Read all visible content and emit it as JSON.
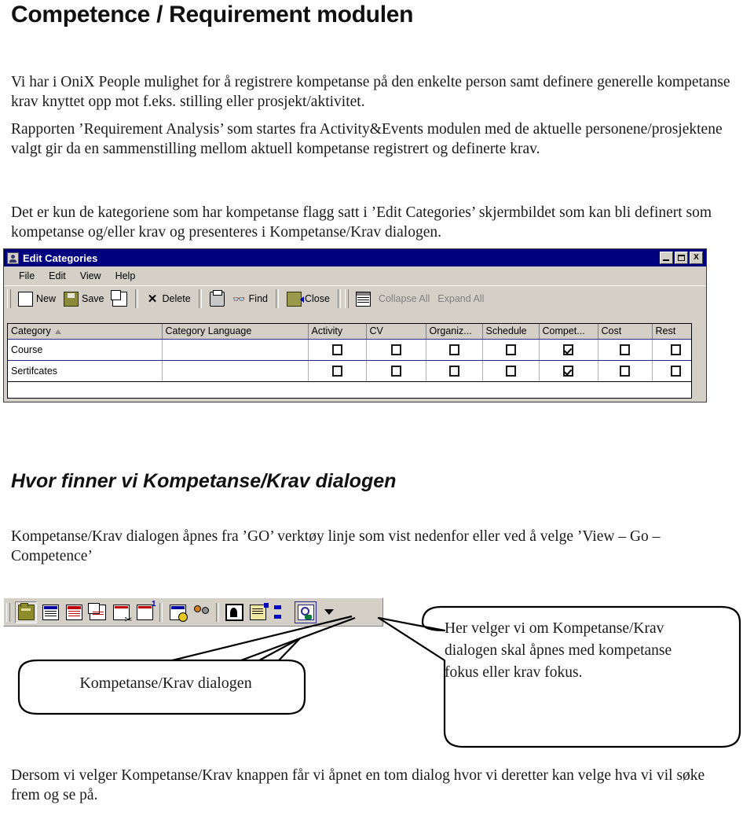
{
  "document": {
    "title": "Competence / Requirement modulen",
    "paragraph_1": "Vi har i OniX People mulighet for å registrere kompetanse på den enkelte person samt definere generelle kompetanse krav knyttet opp mot f.eks. stilling eller prosjekt/aktivitet.",
    "paragraph_2": "Rapporten ’Requirement Analysis’ som startes fra Activity&Events modulen med de aktuelle personene/prosjektene valgt gir da en sammenstilling mellom aktuell kompetanse registrert og definerte krav.",
    "paragraph_3": "Det er kun de kategoriene som har kompetanse flagg satt i ’Edit Categories’ skjermbildet som kan bli definert som kompetanse og/eller krav og presenteres i Kompetanse/Krav dialogen.",
    "subheading": "Hvor finner vi Kompetanse/Krav dialogen",
    "paragraph_4": "Kompetanse/Krav dialogen åpnes fra ’GO’ verktøy linje som vist nedenfor eller ved å velge ’View – Go – Competence’",
    "paragraph_5": "Dersom vi velger Kompetanse/Krav knappen får vi åpnet en tom dialog hvor vi deretter kan velge hva vi vil søke frem og se på."
  },
  "edit_categories_window": {
    "title": "Edit Categories",
    "titlebar_color": "#00007e",
    "window_buttons": [
      {
        "name": "minimize",
        "label": ""
      },
      {
        "name": "maximize",
        "label": ""
      },
      {
        "name": "close",
        "label": "X"
      }
    ],
    "menu": [
      {
        "label": "File"
      },
      {
        "label": "Edit"
      },
      {
        "label": "View"
      },
      {
        "label": "Help"
      }
    ],
    "toolbar": [
      {
        "label": "New",
        "icon": "new-document-icon",
        "disabled": false
      },
      {
        "label": "Save",
        "icon": "save-floppy-icon",
        "disabled": false
      },
      {
        "label": "",
        "icon": "copy-new-icon",
        "disabled": false
      },
      {
        "label": "Delete",
        "icon": "delete-x-icon",
        "disabled": false
      },
      {
        "label": "",
        "icon": "print-icon",
        "disabled": false
      },
      {
        "label": "Find",
        "icon": "find-binoculars-icon",
        "disabled": false
      },
      {
        "label": "Close",
        "icon": "close-door-icon",
        "disabled": false
      },
      {
        "label": "",
        "icon": "grid-view-icon",
        "disabled": false
      },
      {
        "label": "Collapse All",
        "icon": "",
        "disabled": true
      },
      {
        "label": "Expand All",
        "icon": "",
        "disabled": true
      }
    ],
    "grid": {
      "columns": [
        "Category",
        "Category Language",
        "Activity",
        "CV",
        "Organiz...",
        "Schedule",
        "Compet...",
        "Cost",
        "Rest"
      ],
      "sort_column": "Category",
      "sort_direction": "ascending",
      "rows": [
        {
          "category": "Course",
          "category_language": "",
          "activity": false,
          "cv": false,
          "organiz": false,
          "schedule": false,
          "compet": true,
          "cost": false,
          "rest": false
        },
        {
          "category": "Sertifcates",
          "category_language": "",
          "activity": false,
          "cv": false,
          "organiz": false,
          "schedule": false,
          "compet": true,
          "cost": false,
          "rest": false
        }
      ]
    }
  },
  "go_toolbar": {
    "buttons": [
      {
        "name": "folder-button",
        "icon": "folder-icon",
        "state": "pressed"
      },
      {
        "name": "list-blue-button",
        "icon": "list-blue-icon",
        "state": "normal"
      },
      {
        "name": "list-red-button",
        "icon": "list-red-icon",
        "state": "normal"
      },
      {
        "name": "duplicate-button",
        "icon": "duplicate-icon",
        "state": "normal"
      },
      {
        "name": "cut-button",
        "icon": "cut-scissors-icon",
        "state": "normal"
      },
      {
        "name": "add-new-button",
        "icon": "add-new-icon",
        "state": "normal"
      },
      {
        "name": "schedule-button",
        "icon": "schedule-clock-icon",
        "state": "normal"
      },
      {
        "name": "people-button",
        "icon": "people-icon",
        "state": "normal"
      },
      {
        "name": "person-button",
        "icon": "person-photo-icon",
        "state": "normal"
      },
      {
        "name": "notes-button",
        "icon": "notes-pen-icon",
        "state": "normal"
      },
      {
        "name": "transfer-button",
        "icon": "transfer-arrow-icon",
        "state": "normal"
      },
      {
        "name": "competence-button",
        "icon": "competence-icon",
        "state": "framed"
      }
    ],
    "dropdown_caret": "more-options-caret-icon"
  },
  "callouts": {
    "left": "Kompetanse/Krav dialogen",
    "right": "Her velger vi om Kompetanse/Krav dialogen skal åpnes med kompetanse fokus eller krav fokus."
  }
}
